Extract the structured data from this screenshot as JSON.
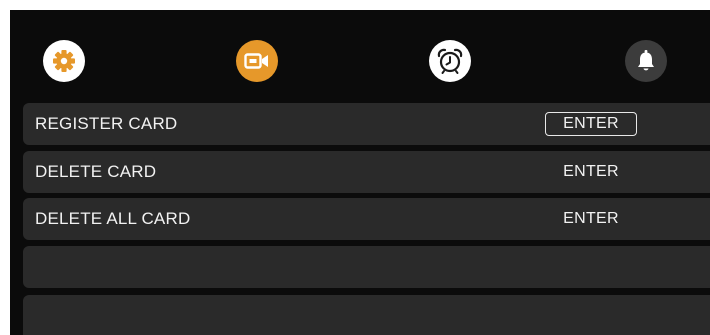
{
  "tabs": [
    {
      "icon": "gear-icon",
      "color": "#e6982a",
      "bg": "#ffffff",
      "active": false
    },
    {
      "icon": "video-camera-icon",
      "color": "#ffffff",
      "bg": "#e6982a",
      "active": true
    },
    {
      "icon": "alarm-clock-icon",
      "color": "#1a1a1a",
      "bg": "#ffffff",
      "active": false
    },
    {
      "icon": "bell-icon",
      "color": "#ffffff",
      "bg": "#3c3c3c",
      "active": false
    }
  ],
  "menu": {
    "items": [
      {
        "label": "REGISTER CARD",
        "action": "ENTER",
        "selected": true
      },
      {
        "label": "DELETE CARD",
        "action": "ENTER",
        "selected": false
      },
      {
        "label": "DELETE ALL CARD",
        "action": "ENTER",
        "selected": false
      },
      {
        "label": "",
        "action": ""
      },
      {
        "label": "",
        "action": ""
      }
    ]
  },
  "colors": {
    "screen_bg": "#0b0b0b",
    "row_bg": "#2a2a2a",
    "accent": "#e6982a",
    "text": "#f2f2f2"
  }
}
